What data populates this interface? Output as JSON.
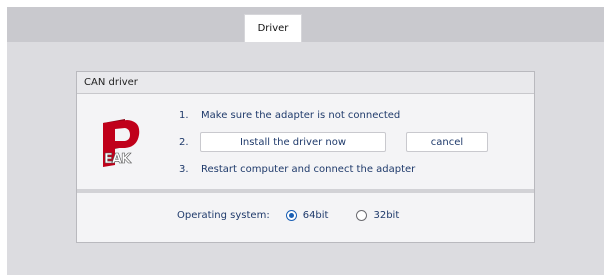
{
  "tabs": [
    {
      "label": "Driver",
      "active": true
    }
  ],
  "panel": {
    "title": "CAN driver",
    "logo_text": "EAK",
    "steps": [
      {
        "number": "1.",
        "text": "Make sure the adapter is not connected"
      },
      {
        "number": "2.",
        "install_label": "Install the driver now",
        "cancel_label": "cancel"
      },
      {
        "number": "3.",
        "text": "Restart computer and connect the adapter"
      }
    ],
    "os": {
      "label": "Operating system:",
      "options": [
        {
          "label": "64bit",
          "selected": true
        },
        {
          "label": "32bit",
          "selected": false
        }
      ]
    }
  },
  "colors": {
    "accent": "#1a5fb4",
    "text": "#1f3a6b",
    "logo_red": "#c0001a"
  }
}
